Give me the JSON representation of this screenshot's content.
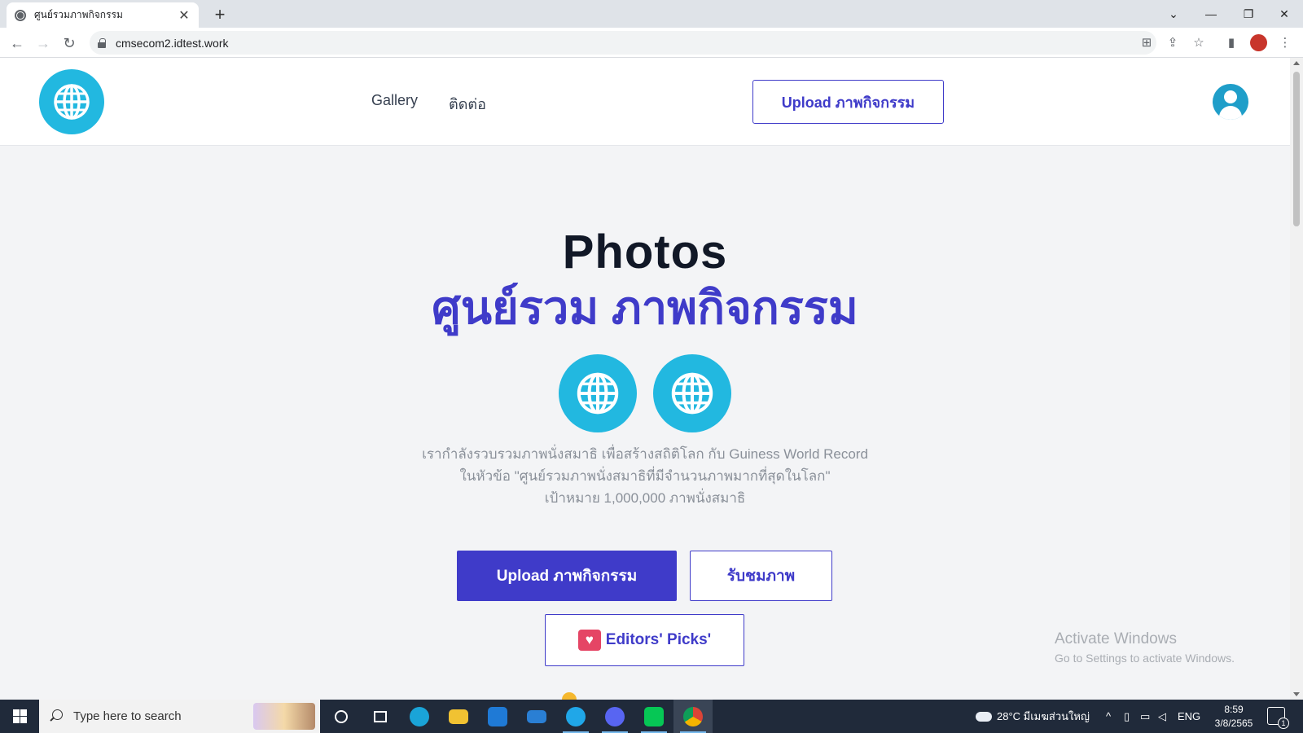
{
  "browser": {
    "tab_title": "ศูนย์รวมภาพกิจกรรม",
    "tab_close": "✕",
    "new_tab": "+",
    "url": "cmsecom2.idtest.work"
  },
  "site": {
    "nav": [
      {
        "label": "Gallery"
      },
      {
        "label": "ติดต่อ"
      }
    ],
    "header_upload_label": "Upload ภาพกิจกรรม"
  },
  "hero": {
    "title_line1": "Photos",
    "title_line2": "ศูนย์รวม ภาพกิจกรรม",
    "description": [
      "เรากำลังรวบรวมภาพนั่งสมาธิ เพื่อสร้างสถิติโลก กับ Guiness World Record",
      "ในหัวข้อ \"ศูนย์รวมภาพนั่งสมาธิที่มีจำนวนภาพมากที่สุดในโลก\"",
      "เป้าหมาย 1,000,000 ภาพนั่งสมาธิ"
    ],
    "upload_label": "Upload ภาพกิจกรรม",
    "view_label": "รับชมภาพ",
    "picks_label": "Editors' Picks'"
  },
  "watermark": {
    "line1": "Activate Windows",
    "line2": "Go to Settings to activate Windows."
  },
  "taskbar": {
    "search_placeholder": "Type here to search",
    "weather": "28°C มีเมฆส่วนใหญ่",
    "language": "ENG",
    "time": "8:59",
    "date": "3/8/2565",
    "notification_count": "1"
  },
  "colors": {
    "brand": "#3f3bc9",
    "globe": "#22b8e0",
    "taskbar": "#202a3a"
  },
  "icons": [
    "globe-icon",
    "user-avatar-icon",
    "heart-icon",
    "lock-icon",
    "back-icon",
    "forward-icon",
    "reload-icon",
    "star-icon",
    "share-icon",
    "translate-icon",
    "sidepanel-icon",
    "menu-icon"
  ]
}
